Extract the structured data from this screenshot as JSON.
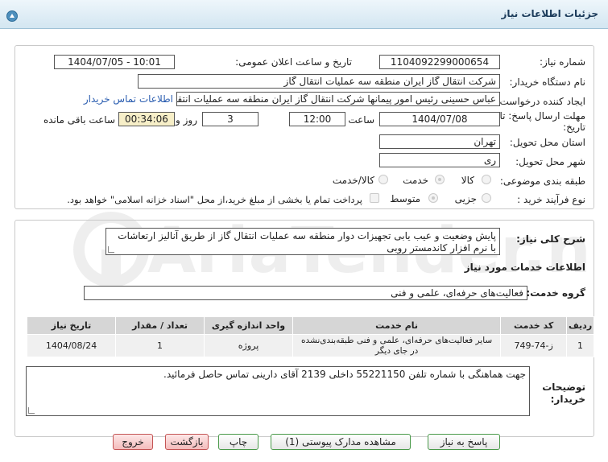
{
  "header": {
    "title": "جزئیات اطلاعات نیاز"
  },
  "form": {
    "need_number_label": "شماره نیاز:",
    "need_number": "1104092299000654",
    "announce_label": "تاریخ و ساعت اعلان عمومی:",
    "announce_value": "1404/07/05 - 10:01",
    "buyer_label": "نام دستگاه خریدار:",
    "buyer_value": "شرکت انتقال گاز ایران منطقه سه عملیات انتقال گاز",
    "creator_label": "ایجاد کننده درخواست:",
    "creator_value": "عباس حسینی رئیس امور پیمانها شرکت انتقال گاز ایران منطقه سه عملیات انتقال گاز",
    "contact_link": "اطلاعات تماس خریدار",
    "deadline_label_1": "مهلت ارسال پاسخ: تا",
    "deadline_label_2": "تاریخ:",
    "deadline_date": "1404/07/08",
    "time_label": "ساعت",
    "deadline_time": "12:00",
    "days_value": "3",
    "days_label": "روز و",
    "remaining_value": "00:34:06",
    "remaining_label": "ساعت باقی مانده",
    "province_label": "استان محل تحویل:",
    "province_value": "تهران",
    "city_label": "شهر محل تحویل:",
    "city_value": "ری",
    "category_label": "طبقه بندی موضوعی:",
    "category_options": [
      "کالا",
      "خدمت",
      "کالا/خدمت"
    ],
    "process_label": "نوع فرآیند خرید :",
    "process_options": [
      "جزیی",
      "متوسط"
    ],
    "payment_note": "پرداخت تمام یا بخشی از مبلغ خرید،از محل \"اسناد خزانه اسلامی\" خواهد بود."
  },
  "details": {
    "summary_label": "شرح کلی نیاز:",
    "summary_value": "پایش وضعیت و عیب یابی تجهیزات دوار منطقه سه عملیات انتقال گاز از طریق آنالیز ارتعاشات با نرم افزار کاندمستر روبی",
    "services_heading": "اطلاعات خدمات مورد نیاز",
    "service_group_label": "گروه خدمت:",
    "service_group_value": "فعالیت‌های حرفه‌ای، علمی و فنی",
    "table": {
      "headers": [
        "ردیف",
        "کد خدمت",
        "نام خدمت",
        "واحد اندازه گیری",
        "تعداد / مقدار",
        "تاریخ نیاز"
      ],
      "rows": [
        [
          "1",
          "ز-74-749",
          "سایر فعالیت‌های حرفه‌ای، علمی و فنی طبقه‌بندی‌نشده در جای دیگر",
          "پروژه",
          "1",
          "1404/08/24"
        ]
      ]
    },
    "notes_label_1": "توضیحات",
    "notes_label_2": "خریدار:",
    "notes_value": "جهت هماهنگی با شماره تلفن 55221150 داخلی 2139 آقای دارینی تماس حاصل فرمائید."
  },
  "buttons": {
    "reply": "پاسخ به نیاز",
    "attachments": "مشاهده مدارک پیوستی (1)",
    "print": "چاپ",
    "back": "بازگشت",
    "exit": "خروج"
  },
  "watermark": {
    "text": "AriaTender.net"
  },
  "colors": {
    "link": "#2a5db0",
    "title_bar": "#d3e6f1",
    "remaining_bg": "#f7efc8",
    "button_border": "#4a9a4a",
    "danger_button": "#f4bcbc"
  }
}
